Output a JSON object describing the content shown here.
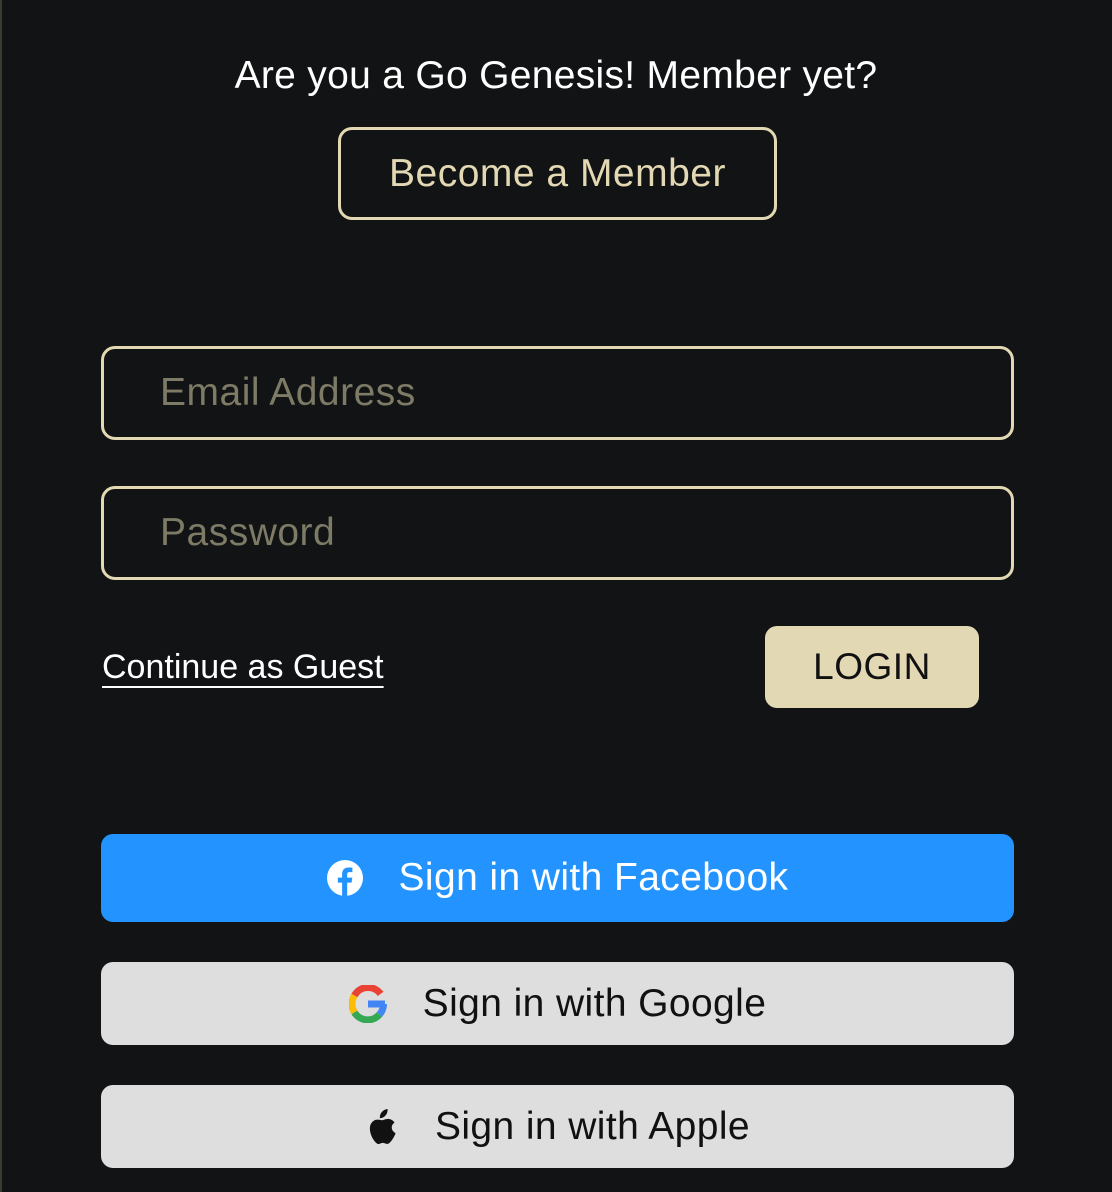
{
  "membership": {
    "prompt": "Are you a Go Genesis! Member yet?",
    "become_member_label": "Become a Member"
  },
  "login_form": {
    "email_placeholder": "Email Address",
    "password_placeholder": "Password",
    "guest_link_label": "Continue as Guest",
    "login_label": "LOGIN"
  },
  "social": {
    "facebook_label": "Sign in with Facebook",
    "facebook_icon": "facebook-icon",
    "google_label": "Sign in with Google",
    "google_icon": "google-icon",
    "apple_label": "Sign in with Apple",
    "apple_icon": "apple-icon"
  },
  "colors": {
    "background": "#121314",
    "accent": "#e2d8b3",
    "facebook_blue": "#2394ff",
    "social_gray": "#dedede",
    "placeholder": "#7d7a66"
  }
}
